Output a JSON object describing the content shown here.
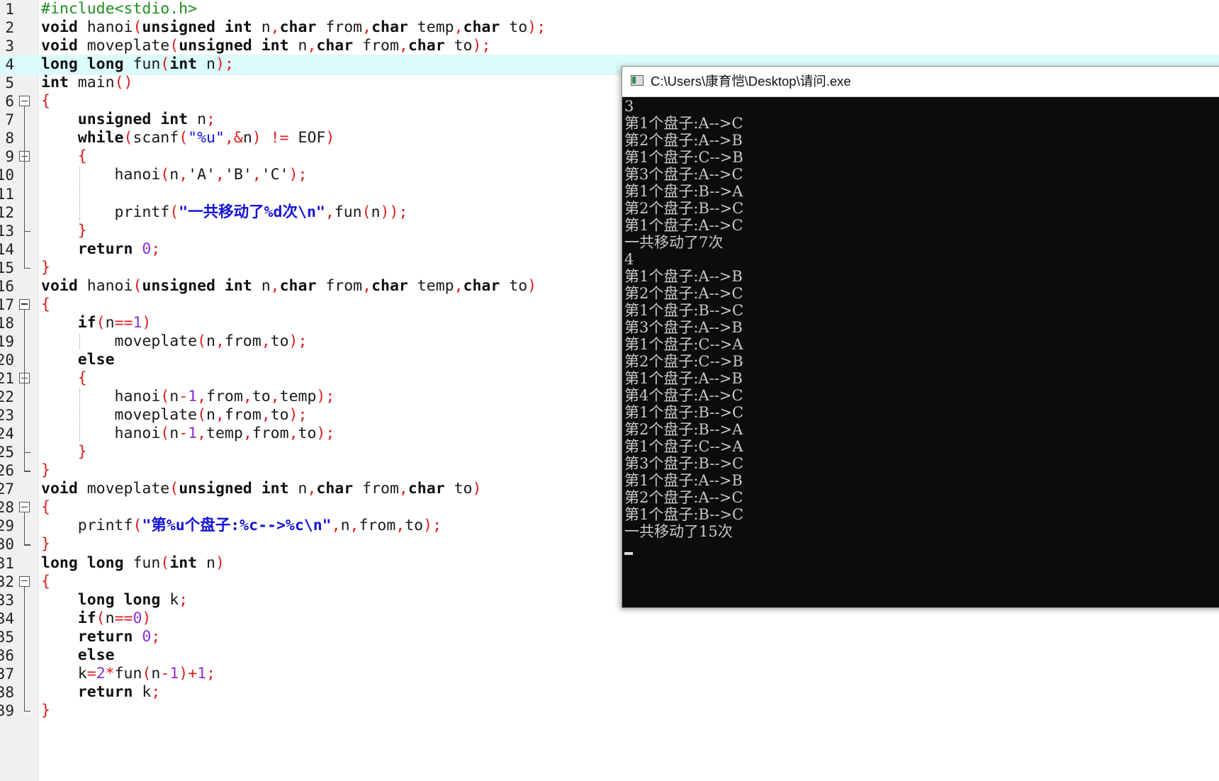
{
  "editor": {
    "lines": [
      {
        "n": "1",
        "html": "<span class='pp'>#include&lt;stdio.h&gt;</span>"
      },
      {
        "n": "2",
        "html": "<span class='kw'>void</span> hanoi<span class='pr'>(</span><span class='kw'>unsigned</span> <span class='kw'>int</span> n<span class='op'>,</span><span class='kw'>char</span> from<span class='op'>,</span><span class='kw'>char</span> temp<span class='op'>,</span><span class='kw'>char</span> to<span class='pr'>)</span><span class='op'>;</span>"
      },
      {
        "n": "3",
        "html": "<span class='kw'>void</span> moveplate<span class='pr'>(</span><span class='kw'>unsigned</span> <span class='kw'>int</span> n<span class='op'>,</span><span class='kw'>char</span> from<span class='op'>,</span><span class='kw'>char</span> to<span class='pr'>)</span><span class='op'>;</span>"
      },
      {
        "n": "4",
        "html": "<span class='kw'>long</span> <span class='kw'>long</span> fun<span class='pr'>(</span><span class='kw'>int</span> n<span class='pr'>)</span><span class='op'>;</span>",
        "current": true
      },
      {
        "n": "5",
        "html": "<span class='kw'>int</span> main<span class='pr'>()</span>"
      },
      {
        "n": "6",
        "html": "<span class='pr'>{</span>",
        "fold": true
      },
      {
        "n": "7",
        "html": "    <span class='kw'>unsigned</span> <span class='kw'>int</span> n<span class='op'>;</span>"
      },
      {
        "n": "8",
        "html": "    <span class='kw'>while</span><span class='pr'>(</span>scanf<span class='pr'>(</span><span class='st'>\"%u\"</span><span class='op'>,&amp;</span>n<span class='pr'>)</span> <span class='op'>!=</span> EOF<span class='pr'>)</span>"
      },
      {
        "n": "9",
        "html": "    <span class='pr'>{</span>",
        "fold": true
      },
      {
        "n": "10",
        "html": "        hanoi<span class='pr'>(</span>n<span class='op'>,</span>'A'<span class='op'>,</span>'B'<span class='op'>,</span>'C'<span class='pr'>)</span><span class='op'>;</span>"
      },
      {
        "n": "11",
        "html": ""
      },
      {
        "n": "12",
        "html": "        printf<span class='pr'>(</span><span class='bi'>\"一共移动了%d次\\n\"</span><span class='op'>,</span>fun<span class='pr'>(</span>n<span class='pr'>))</span><span class='op'>;</span>"
      },
      {
        "n": "13",
        "html": "    <span class='pr'>}</span>",
        "end": true
      },
      {
        "n": "14",
        "html": "    <span class='kw'>return</span> <span class='num'>0</span><span class='op'>;</span>"
      },
      {
        "n": "15",
        "html": "<span class='pr'>}</span>",
        "end": true
      },
      {
        "n": "16",
        "html": "<span class='kw'>void</span> hanoi<span class='pr'>(</span><span class='kw'>unsigned</span> <span class='kw'>int</span> n<span class='op'>,</span><span class='kw'>char</span> from<span class='op'>,</span><span class='kw'>char</span> temp<span class='op'>,</span><span class='kw'>char</span> to<span class='pr'>)</span>"
      },
      {
        "n": "17",
        "html": "<span class='pr'>{</span>",
        "fold": true
      },
      {
        "n": "18",
        "html": "    <span class='kw'>if</span><span class='pr'>(</span>n<span class='op'>==</span><span class='num'>1</span><span class='pr'>)</span>"
      },
      {
        "n": "19",
        "html": "        moveplate<span class='pr'>(</span>n<span class='op'>,</span>from<span class='op'>,</span>to<span class='pr'>)</span><span class='op'>;</span>"
      },
      {
        "n": "20",
        "html": "    <span class='kw'>else</span>"
      },
      {
        "n": "21",
        "html": "    <span class='pr'>{</span>",
        "fold": true
      },
      {
        "n": "22",
        "html": "        hanoi<span class='pr'>(</span>n<span class='op'>-</span><span class='num'>1</span><span class='op'>,</span>from<span class='op'>,</span>to<span class='op'>,</span>temp<span class='pr'>)</span><span class='op'>;</span>"
      },
      {
        "n": "23",
        "html": "        moveplate<span class='pr'>(</span>n<span class='op'>,</span>from<span class='op'>,</span>to<span class='pr'>)</span><span class='op'>;</span>"
      },
      {
        "n": "24",
        "html": "        hanoi<span class='pr'>(</span>n<span class='op'>-</span><span class='num'>1</span><span class='op'>,</span>temp<span class='op'>,</span>from<span class='op'>,</span>to<span class='pr'>)</span><span class='op'>;</span>"
      },
      {
        "n": "25",
        "html": "    <span class='pr'>}</span>",
        "end": true
      },
      {
        "n": "26",
        "html": "<span class='pr'>}</span>",
        "end": true
      },
      {
        "n": "27",
        "html": "<span class='kw'>void</span> moveplate<span class='pr'>(</span><span class='kw'>unsigned</span> <span class='kw'>int</span> n<span class='op'>,</span><span class='kw'>char</span> from<span class='op'>,</span><span class='kw'>char</span> to<span class='pr'>)</span>"
      },
      {
        "n": "28",
        "html": "<span class='pr'>{</span>",
        "fold": true
      },
      {
        "n": "29",
        "html": "    printf<span class='pr'>(</span><span class='bi'>\"第%u个盘子:%c--&gt;%c\\n\"</span><span class='op'>,</span>n<span class='op'>,</span>from<span class='op'>,</span>to<span class='pr'>)</span><span class='op'>;</span>"
      },
      {
        "n": "30",
        "html": "<span class='pr'>}</span>",
        "end": true
      },
      {
        "n": "31",
        "html": "<span class='kw'>long</span> <span class='kw'>long</span> fun<span class='pr'>(</span><span class='kw'>int</span> n<span class='pr'>)</span>"
      },
      {
        "n": "32",
        "html": "<span class='pr'>{</span>",
        "fold": true
      },
      {
        "n": "33",
        "html": "    <span class='kw'>long</span> <span class='kw'>long</span> k<span class='op'>;</span>"
      },
      {
        "n": "34",
        "html": "    <span class='kw'>if</span><span class='pr'>(</span>n<span class='op'>==</span><span class='num'>0</span><span class='pr'>)</span>"
      },
      {
        "n": "35",
        "html": "    <span class='kw'>return</span> <span class='num'>0</span><span class='op'>;</span>"
      },
      {
        "n": "36",
        "html": "    <span class='kw'>else</span>"
      },
      {
        "n": "37",
        "html": "    k<span class='op'>=</span><span class='num'>2</span><span class='op'>*</span>fun<span class='pr'>(</span>n<span class='op'>-</span><span class='num'>1</span><span class='pr'>)</span><span class='op'>+</span><span class='num'>1</span><span class='op'>;</span>"
      },
      {
        "n": "38",
        "html": "    <span class='kw'>return</span> k<span class='op'>;</span>"
      },
      {
        "n": "39",
        "html": "<span class='pr'>}</span>"
      }
    ]
  },
  "console": {
    "title": "C:\\Users\\康育恺\\Desktop\\请问.exe",
    "output": [
      "3",
      "第1个盘子:A-->C",
      "第2个盘子:A-->B",
      "第1个盘子:C-->B",
      "第3个盘子:A-->C",
      "第1个盘子:B-->A",
      "第2个盘子:B-->C",
      "第1个盘子:A-->C",
      "一共移动了7次",
      "4",
      "第1个盘子:A-->B",
      "第2个盘子:A-->C",
      "第1个盘子:B-->C",
      "第3个盘子:A-->B",
      "第1个盘子:C-->A",
      "第2个盘子:C-->B",
      "第1个盘子:A-->B",
      "第4个盘子:A-->C",
      "第1个盘子:B-->C",
      "第2个盘子:B-->A",
      "第1个盘子:C-->A",
      "第3个盘子:B-->C",
      "第1个盘子:A-->B",
      "第2个盘子:A-->C",
      "第1个盘子:B-->C",
      "一共移动了15次"
    ]
  }
}
